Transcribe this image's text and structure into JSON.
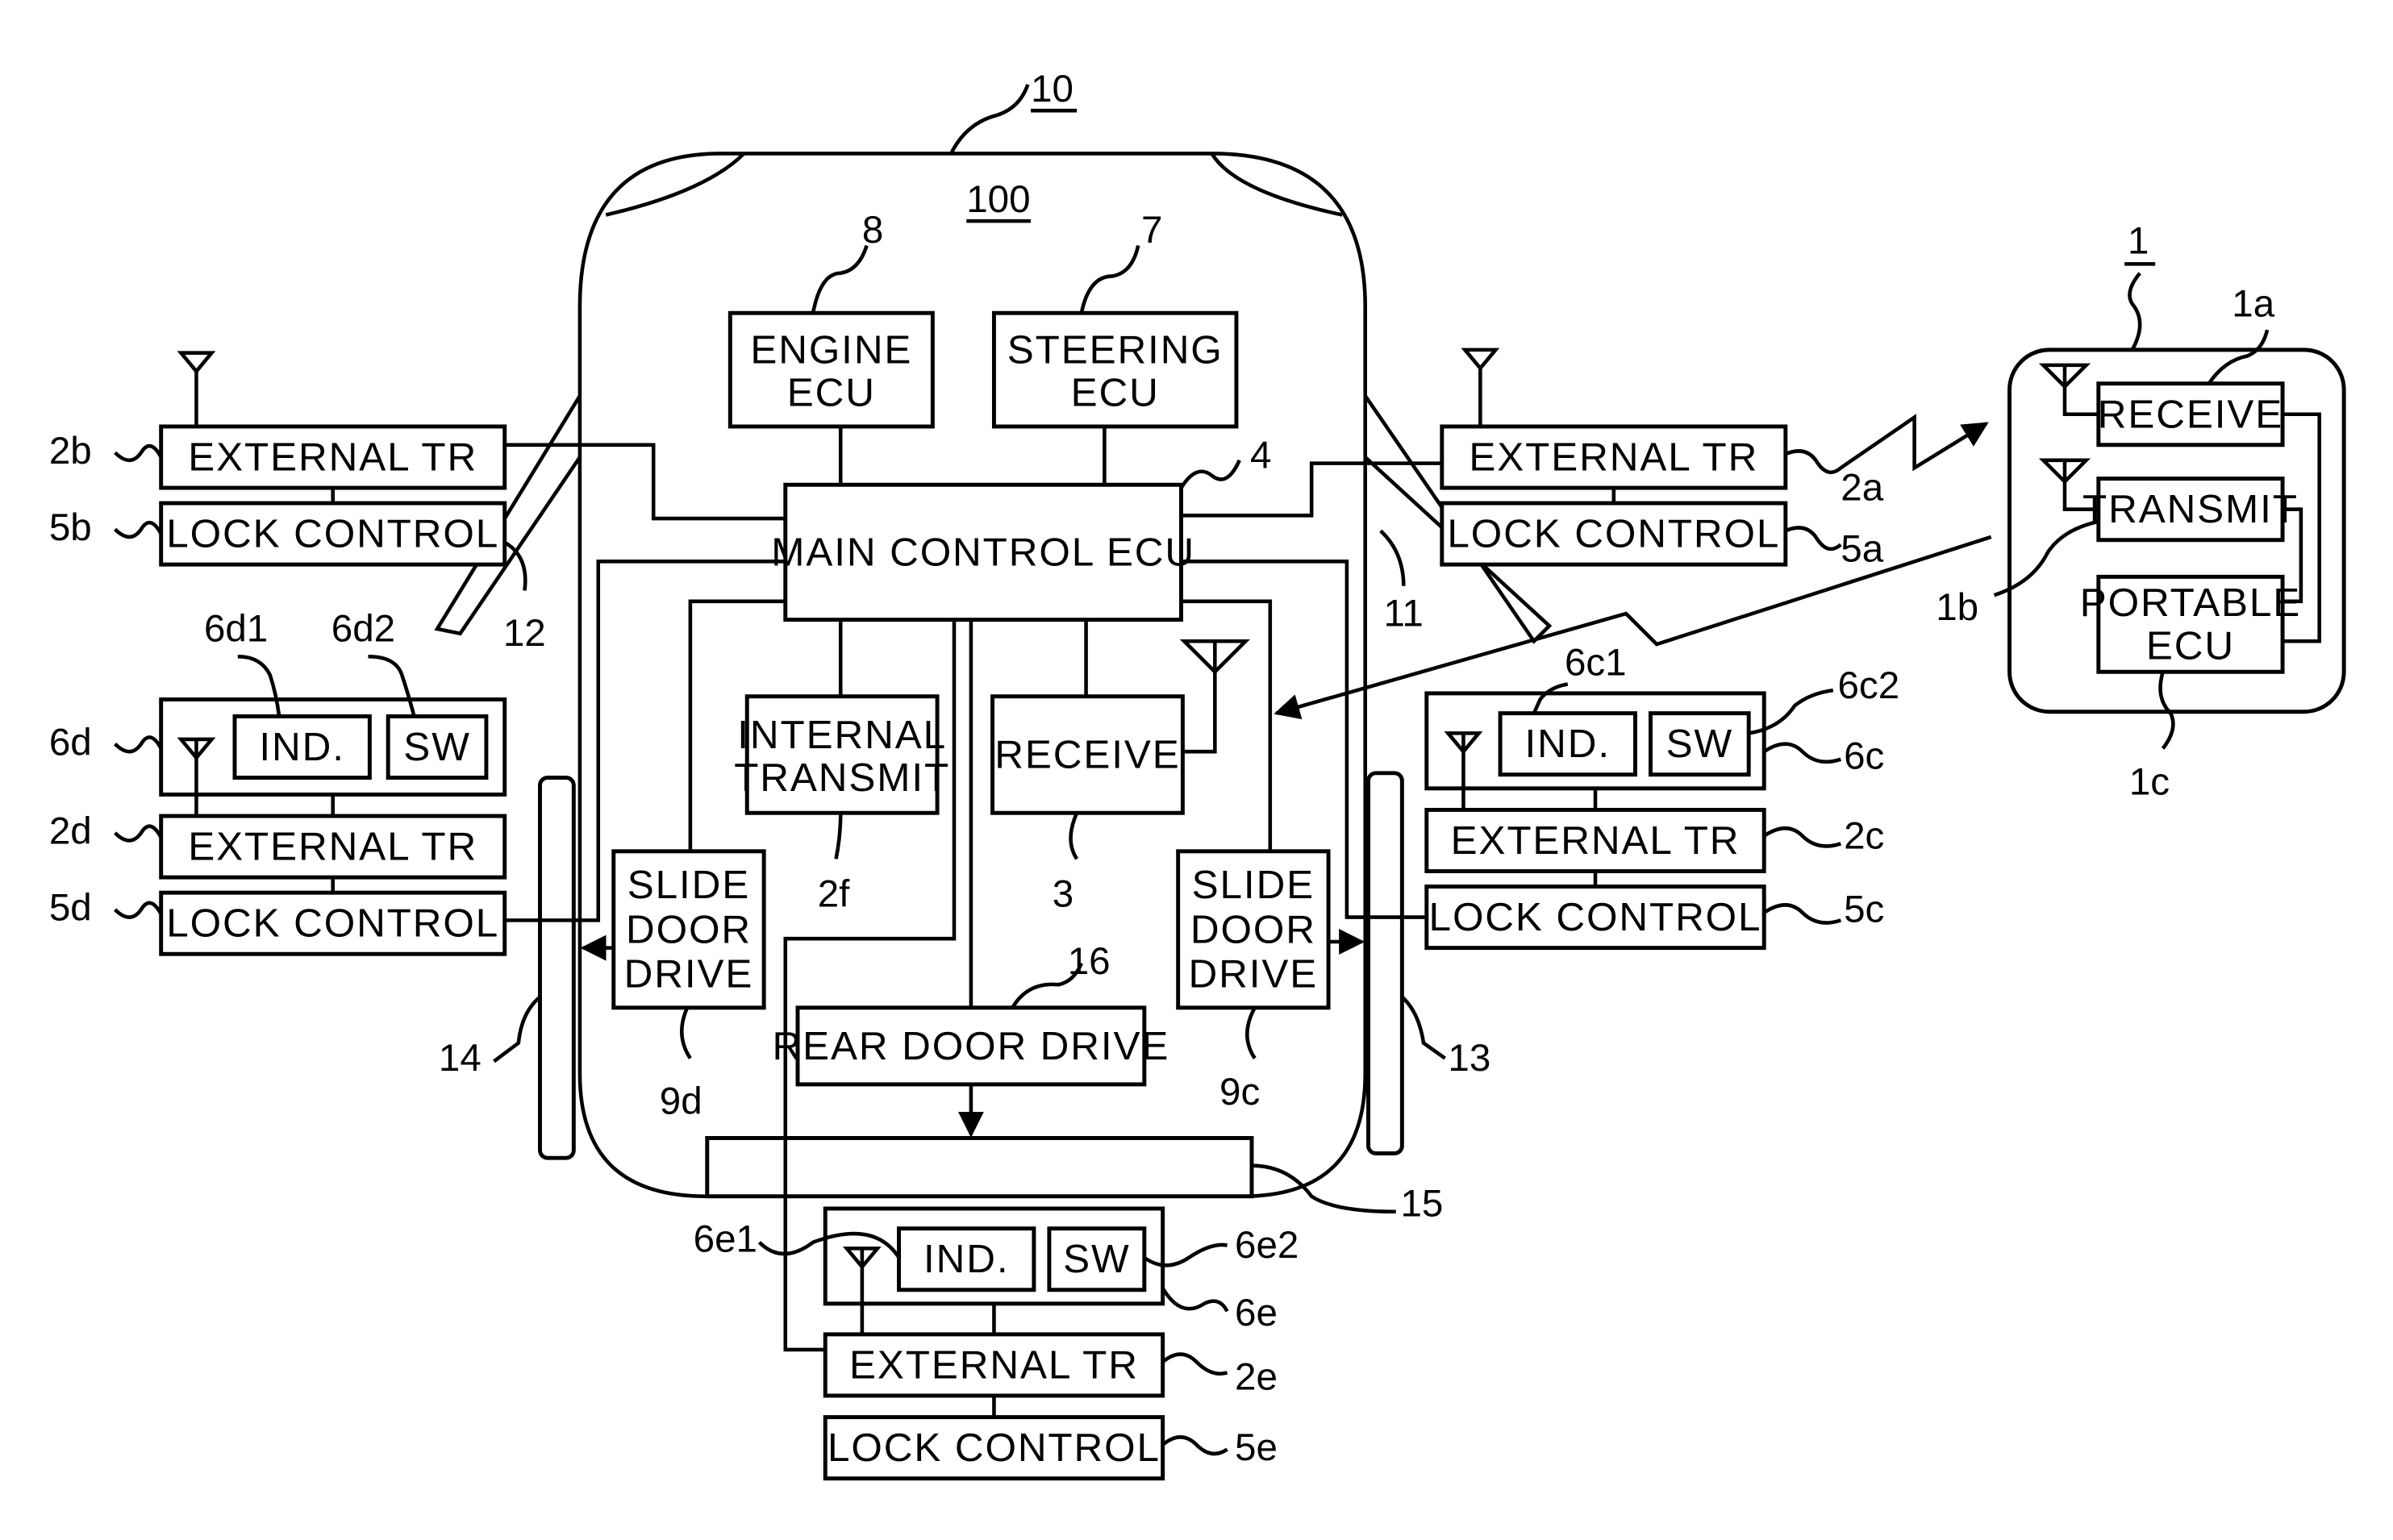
{
  "figure": {
    "vehicle_ref": "10",
    "vehicle_body_ref": "100",
    "portable_ref": "1"
  },
  "blocks": {
    "engine_ecu": {
      "line1": "ENGINE",
      "line2": "ECU",
      "ref": "8"
    },
    "steering_ecu": {
      "line1": "STEERING",
      "line2": "ECU",
      "ref": "7"
    },
    "main_ecu": {
      "label": "MAIN CONTROL ECU",
      "ref": "4"
    },
    "internal_transmit": {
      "line1": "INTERNAL",
      "line2": "TRANSMIT",
      "ref": "2f"
    },
    "receive": {
      "label": "RECEIVE",
      "ref": "3"
    },
    "slide_door_left": {
      "line1": "SLIDE",
      "line2": "DOOR",
      "line3": "DRIVE",
      "ref": "9d"
    },
    "slide_door_right": {
      "line1": "SLIDE",
      "line2": "DOOR",
      "line3": "DRIVE",
      "ref": "9c"
    },
    "rear_door_drive": {
      "label": "REAR DOOR DRIVE",
      "ref": "16"
    },
    "rear_door_ref": "15",
    "front_left_door_ref": "12",
    "front_right_door_ref": "11",
    "slide_left_ref": "14",
    "slide_right_ref": "13"
  },
  "units": {
    "a": {
      "tr": "EXTERNAL TR",
      "lock": "LOCK CONTROL",
      "tr_ref": "2a",
      "lock_ref": "5a"
    },
    "b": {
      "tr": "EXTERNAL TR",
      "lock": "LOCK CONTROL",
      "tr_ref": "2b",
      "lock_ref": "5b"
    },
    "c": {
      "tr": "EXTERNAL TR",
      "lock": "LOCK CONTROL",
      "tr_ref": "2c",
      "lock_ref": "5c",
      "ind": "IND.",
      "sw": "SW",
      "panel_ref": "6c",
      "ind_ref": "6c1",
      "sw_ref": "6c2"
    },
    "d": {
      "tr": "EXTERNAL TR",
      "lock": "LOCK CONTROL",
      "tr_ref": "2d",
      "lock_ref": "5d",
      "ind": "IND.",
      "sw": "SW",
      "panel_ref": "6d",
      "ind_ref": "6d1",
      "sw_ref": "6d2"
    },
    "e": {
      "tr": "EXTERNAL TR",
      "lock": "LOCK CONTROL",
      "tr_ref": "2e",
      "lock_ref": "5e",
      "ind": "IND.",
      "sw": "SW",
      "panel_ref": "6e",
      "ind_ref": "6e1",
      "sw_ref": "6e2"
    }
  },
  "portable": {
    "receive": {
      "label": "RECEIVE",
      "ref": "1a"
    },
    "transmit": {
      "label": "TRANSMIT",
      "ref": "1b"
    },
    "ecu": {
      "line1": "PORTABLE",
      "line2": "ECU",
      "ref": "1c"
    }
  }
}
